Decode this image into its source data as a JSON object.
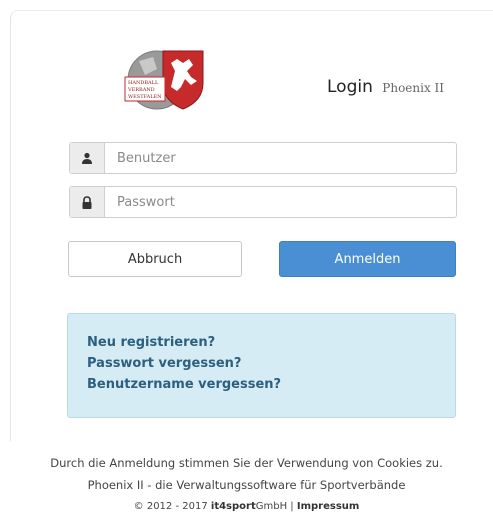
{
  "logo": {
    "text_lines": [
      "HANDBALL",
      "VERBAND",
      "WESTFALEN"
    ]
  },
  "header": {
    "title": "Login",
    "subtitle": "Phoenix II"
  },
  "form": {
    "username": {
      "placeholder": "Benutzer",
      "value": ""
    },
    "password": {
      "placeholder": "Passwort",
      "value": ""
    },
    "cancel_label": "Abbruch",
    "login_label": "Anmelden"
  },
  "links": {
    "register": "Neu registrieren?",
    "forgot_password": "Passwort vergessen?",
    "forgot_username": "Benutzername vergessen?"
  },
  "footer": {
    "cookie_notice": "Durch die Anmeldung stimmen Sie der Verwendung von Cookies zu.",
    "tagline": "Phoenix II - die Verwaltungssoftware für Sportverbände",
    "copyright_prefix": "© 2012 - 2017",
    "company_brand": "it4sport",
    "company_suffix": "GmbH",
    "separator": "|",
    "imprint": "Impressum"
  },
  "colors": {
    "primary_button": "#4a8fd4",
    "info_box_bg": "#d5ecf5",
    "link_text": "#2d5f7f"
  },
  "icons": {
    "username": "user-icon",
    "password": "lock-icon"
  }
}
